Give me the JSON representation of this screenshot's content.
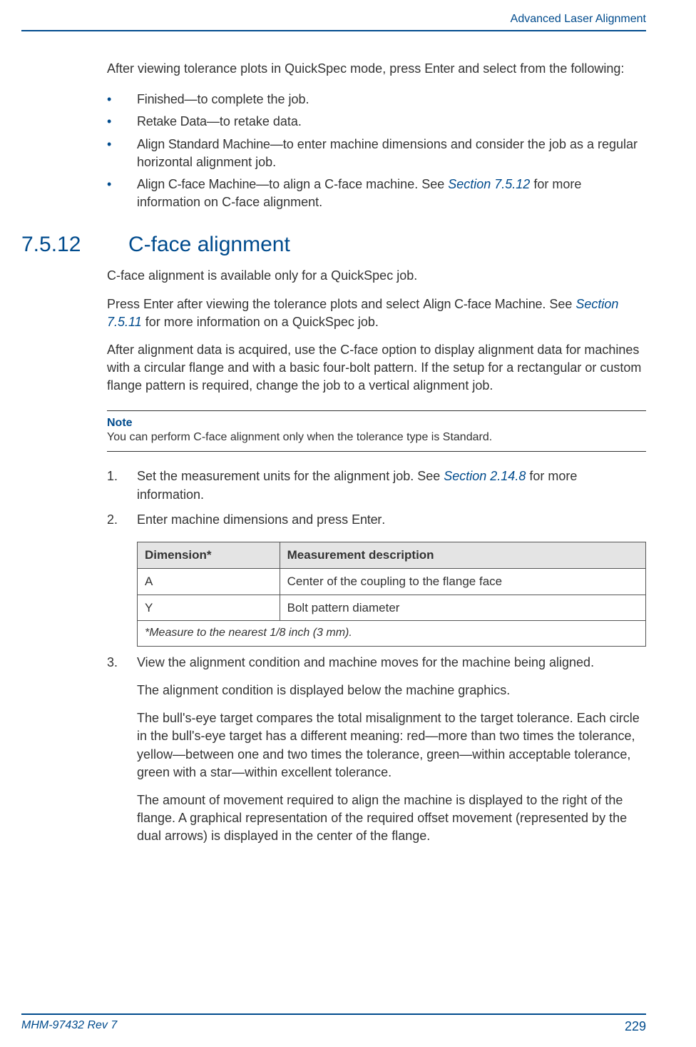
{
  "header": {
    "running": "Advanced Laser Alignment"
  },
  "intro": {
    "lead_a": "After viewing tolerance plots in QuickSpec mode, press ",
    "lead_key": "Enter",
    "lead_b": " and select from the following:"
  },
  "options": [
    {
      "name": "Finished",
      "desc": "—to complete the job."
    },
    {
      "name": "Retake Data",
      "desc": "—to retake data."
    },
    {
      "name": "Align Standard Machine",
      "desc": "—to enter machine dimensions and consider the job as a regular horizontal alignment job."
    },
    {
      "name": "Align C-face Machine",
      "desc_a": "—to align a C-face machine. See ",
      "link": "Section 7.5.12",
      "desc_b": " for more information on C-face alignment."
    }
  ],
  "section": {
    "num": "7.5.12",
    "title": "C-face alignment"
  },
  "body": {
    "p1": "C-face alignment is available only for a QuickSpec job.",
    "p2a": "Press ",
    "p2key1": "Enter",
    "p2b": " after viewing the tolerance plots and select ",
    "p2key2": "Align C-face Machine",
    "p2c": ". See ",
    "p2link": "Section 7.5.11",
    "p2d": " for more information on a QuickSpec job.",
    "p3": "After alignment data is acquired, use the C-face option to display alignment data for machines with a circular flange and with a basic four-bolt pattern. If the setup for a rectangular or custom flange pattern is required, change the job to a vertical alignment job."
  },
  "note": {
    "label": "Note",
    "text": "You can perform C-face alignment only when the tolerance type is Standard."
  },
  "steps": {
    "s1a": "Set the measurement units for the alignment job. See ",
    "s1link": "Section 2.14.8",
    "s1b": " for more information.",
    "s2a": "Enter machine dimensions and press ",
    "s2key": "Enter",
    "s2b": ".",
    "s3": "View the alignment condition and machine moves for the machine being aligned.",
    "s3p1": "The alignment condition is displayed below the machine graphics.",
    "s3p2": "The bull's-eye target compares the total misalignment to the target tolerance. Each circle in the bull's-eye target has a different meaning: red—more than two times the tolerance, yellow—between one and two times the tolerance, green—within acceptable tolerance, green with a star—within excellent tolerance.",
    "s3p3": "The amount of movement required to align the machine is displayed to the right of the flange. A graphical representation of the required offset movement (represented by the dual arrows) is displayed in the center of the flange."
  },
  "table": {
    "h1": "Dimension*",
    "h2": "Measurement description",
    "rows": [
      {
        "c1": "A",
        "c2": "Center of the coupling to the flange face"
      },
      {
        "c1": "Y",
        "c2": "Bolt pattern diameter"
      }
    ],
    "foot": "*Measure to the nearest 1/8 inch (3 mm)."
  },
  "footer": {
    "doc": "MHM-97432 Rev 7",
    "page": "229"
  }
}
